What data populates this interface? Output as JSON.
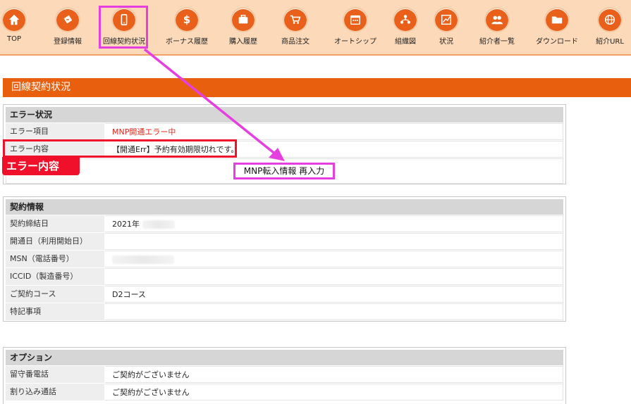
{
  "nav": {
    "items": [
      {
        "id": "top",
        "label": "TOP",
        "icon": "home-icon",
        "glyph": "⌂"
      },
      {
        "id": "registration",
        "label": "登録情報",
        "icon": "register-icon",
        "glyph": "✎"
      },
      {
        "id": "line-contract",
        "label": "回線契約状況",
        "icon": "smartphone-icon",
        "glyph": "▯"
      },
      {
        "id": "bonus",
        "label": "ボーナス履歴",
        "icon": "dollar-icon",
        "glyph": "$"
      },
      {
        "id": "purchase",
        "label": "購入履歴",
        "icon": "briefcase-icon",
        "glyph": "▰"
      },
      {
        "id": "order",
        "label": "商品注文",
        "icon": "cart-icon",
        "glyph": "⛟"
      },
      {
        "id": "autoship",
        "label": "オートシップ",
        "icon": "calendar-icon",
        "glyph": "▦"
      },
      {
        "id": "org",
        "label": "組織図",
        "icon": "org-chart-icon",
        "glyph": "⚇"
      },
      {
        "id": "status",
        "label": "状況",
        "icon": "chart-icon",
        "glyph": "↗"
      },
      {
        "id": "referrers",
        "label": "紹介者一覧",
        "icon": "users-icon",
        "glyph": "☺"
      },
      {
        "id": "download",
        "label": "ダウンロード",
        "icon": "folder-icon",
        "glyph": "▬"
      },
      {
        "id": "referral-url",
        "label": "紹介URL",
        "icon": "globe-icon",
        "glyph": "◍"
      }
    ]
  },
  "page": {
    "title": "回線契約状況"
  },
  "error_status": {
    "heading": "エラー状況",
    "rows": [
      {
        "label": "エラー項目",
        "value": "MNP開通エラー中"
      },
      {
        "label": "エラー内容",
        "value": "【開通Err】予約有効期限切れです。"
      }
    ],
    "action_label": "MNP転入情報 再入力"
  },
  "annotation": {
    "error_tag": "エラー内容"
  },
  "contract": {
    "heading": "契約情報",
    "rows": [
      {
        "label": "契約締結日",
        "value": "2021年"
      },
      {
        "label": "開通日（利用開始日）",
        "value": ""
      },
      {
        "label": "MSN（電話番号）",
        "value": ""
      },
      {
        "label": "ICCID（製造番号）",
        "value": ""
      },
      {
        "label": "ご契約コース",
        "value": "D2コース"
      },
      {
        "label": "特記事項",
        "value": ""
      }
    ]
  },
  "options": {
    "heading": "オプション",
    "rows": [
      {
        "label": "留守番電話",
        "value": "ご契約がございません"
      },
      {
        "label": "割り込み通話",
        "value": "ご契約がございません"
      }
    ]
  },
  "colors": {
    "accent": "#e8600e",
    "nav_bg": "#fcd9b8",
    "highlight": "#e63fe0",
    "error": "#f0102a"
  }
}
